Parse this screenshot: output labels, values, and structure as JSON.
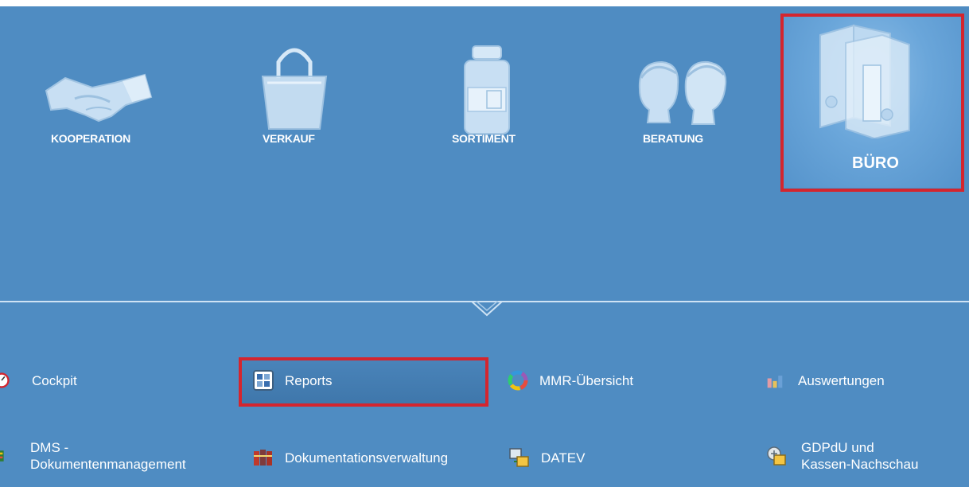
{
  "categories": [
    {
      "id": "kooperation",
      "label": "KOOPERATION",
      "icon": "handshake-icon"
    },
    {
      "id": "verkauf",
      "label": "VERKAUF",
      "icon": "shopping-bag-icon"
    },
    {
      "id": "sortiment",
      "label": "SORTIMENT",
      "icon": "medicine-bottle-icon"
    },
    {
      "id": "beratung",
      "label": "BERATUNG",
      "icon": "people-heads-icon"
    },
    {
      "id": "buero",
      "label": "BÜRO",
      "icon": "binders-icon",
      "selected": true
    }
  ],
  "menu": {
    "cockpit": {
      "label": "Cockpit",
      "icon": "gauge-icon"
    },
    "reports": {
      "label": "Reports",
      "icon": "reports-grid-icon",
      "selected": true
    },
    "mmr": {
      "label": "MMR-Übersicht",
      "icon": "color-ring-icon"
    },
    "auswertungen": {
      "label": "Auswertungen",
      "icon": "bar-chart-icon"
    },
    "dms_line1": {
      "label": "DMS -"
    },
    "dms_line2": {
      "label": "Dokumentenmanagement"
    },
    "dms": {
      "icon": "document-binder-icon"
    },
    "dokumentation": {
      "label": "Dokumentationsverwaltung",
      "icon": "books-icon"
    },
    "datev": {
      "label": "DATEV",
      "icon": "datev-transfer-icon"
    },
    "gdpdu_line1": {
      "label": "GDPdU und"
    },
    "gdpdu_line2": {
      "label": "Kassen-Nachschau"
    },
    "gdpdu": {
      "icon": "audit-box-icon"
    }
  },
  "colors": {
    "background": "#4f8cc2",
    "highlight_border": "#d4252e",
    "text": "#ffffff"
  }
}
